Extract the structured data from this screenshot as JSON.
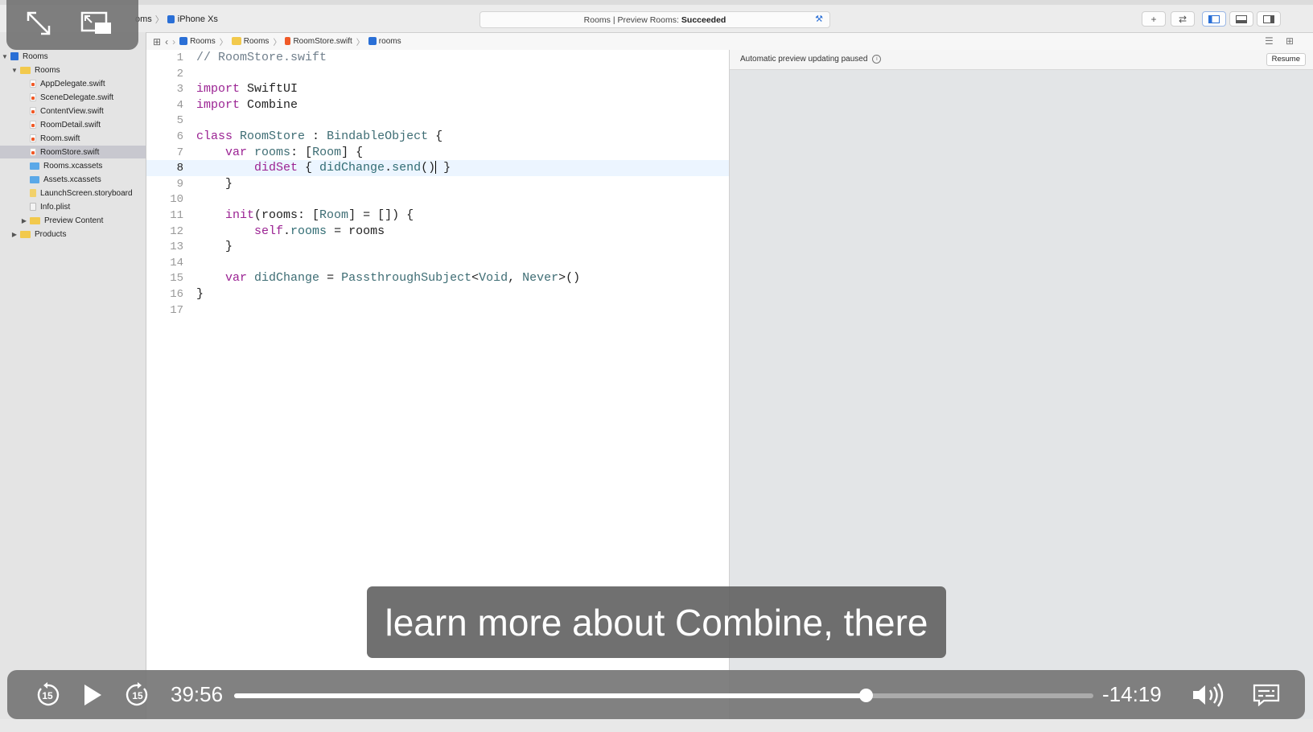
{
  "toolbar": {
    "scheme_app": "oms",
    "scheme_device": "iPhone Xs",
    "status_prefix": "Rooms | Preview Rooms:",
    "status_result": "Succeeded"
  },
  "navigator": {
    "items": [
      {
        "label": "Rooms",
        "type": "project",
        "indent": 0,
        "disclosure": "open"
      },
      {
        "label": "Rooms",
        "type": "folder",
        "indent": 1,
        "disclosure": "open"
      },
      {
        "label": "AppDelegate.swift",
        "type": "swift",
        "indent": 2
      },
      {
        "label": "SceneDelegate.swift",
        "type": "swift",
        "indent": 2
      },
      {
        "label": "ContentView.swift",
        "type": "swift",
        "indent": 2
      },
      {
        "label": "RoomDetail.swift",
        "type": "swift",
        "indent": 2
      },
      {
        "label": "Room.swift",
        "type": "swift",
        "indent": 2
      },
      {
        "label": "RoomStore.swift",
        "type": "swift",
        "indent": 2,
        "selected": true
      },
      {
        "label": "Rooms.xcassets",
        "type": "assets",
        "indent": 2
      },
      {
        "label": "Assets.xcassets",
        "type": "assets",
        "indent": 2
      },
      {
        "label": "LaunchScreen.storyboard",
        "type": "story",
        "indent": 2
      },
      {
        "label": "Info.plist",
        "type": "plist",
        "indent": 2
      },
      {
        "label": "Preview Content",
        "type": "folder",
        "indent": 2,
        "disclosure": "closed"
      },
      {
        "label": "Products",
        "type": "folder",
        "indent": 1,
        "disclosure": "closed"
      }
    ]
  },
  "jumpbar": {
    "crumbs": [
      "Rooms",
      "Rooms",
      "RoomStore.swift",
      "rooms"
    ]
  },
  "editor": {
    "current_line": 8,
    "lines": [
      {
        "n": "1",
        "html": "<span class=\"cm\">// RoomStore.swift</span>"
      },
      {
        "n": "2",
        "html": ""
      },
      {
        "n": "3",
        "html": "<span class=\"kw\">import</span> SwiftUI"
      },
      {
        "n": "4",
        "html": "<span class=\"kw\">import</span> Combine"
      },
      {
        "n": "5",
        "html": ""
      },
      {
        "n": "6",
        "html": "<span class=\"kw\">class</span> <span class=\"ty\">RoomStore</span> : <span class=\"ty\">BindableObject</span> {"
      },
      {
        "n": "7",
        "html": "    <span class=\"kw\">var</span> <span class=\"ty\">rooms</span>: [<span class=\"ty\">Room</span>] {"
      },
      {
        "n": "8",
        "html": "        <span class=\"kw\">didSet</span> { <span class=\"pr\">didChange</span>.<span class=\"pr\">send</span>()<span class=\"cursor\"></span> }"
      },
      {
        "n": "9",
        "html": "    }"
      },
      {
        "n": "10",
        "html": ""
      },
      {
        "n": "11",
        "html": "    <span class=\"kw\">init</span>(rooms: [<span class=\"ty\">Room</span>] = []) {"
      },
      {
        "n": "12",
        "html": "        <span class=\"kw\">self</span>.<span class=\"pr\">rooms</span> = rooms"
      },
      {
        "n": "13",
        "html": "    }"
      },
      {
        "n": "14",
        "html": ""
      },
      {
        "n": "15",
        "html": "    <span class=\"kw\">var</span> <span class=\"ty\">didChange</span> = <span class=\"ty\">PassthroughSubject</span>&lt;<span class=\"ty\">Void</span>, <span class=\"ty\">Never</span>&gt;()"
      },
      {
        "n": "16",
        "html": "}"
      },
      {
        "n": "17",
        "html": ""
      }
    ]
  },
  "canvas": {
    "paused_text": "Automatic preview updating paused",
    "resume_label": "Resume"
  },
  "video": {
    "caption": "learn more about Combine, there",
    "elapsed": "39:56",
    "remaining": "-14:19",
    "progress": 0.7347,
    "skip_seconds": "15"
  },
  "colors": {
    "keyword": "#9b2393",
    "type": "#3e6d74",
    "comment": "#707f8c",
    "accent": "#2a6fd6"
  }
}
